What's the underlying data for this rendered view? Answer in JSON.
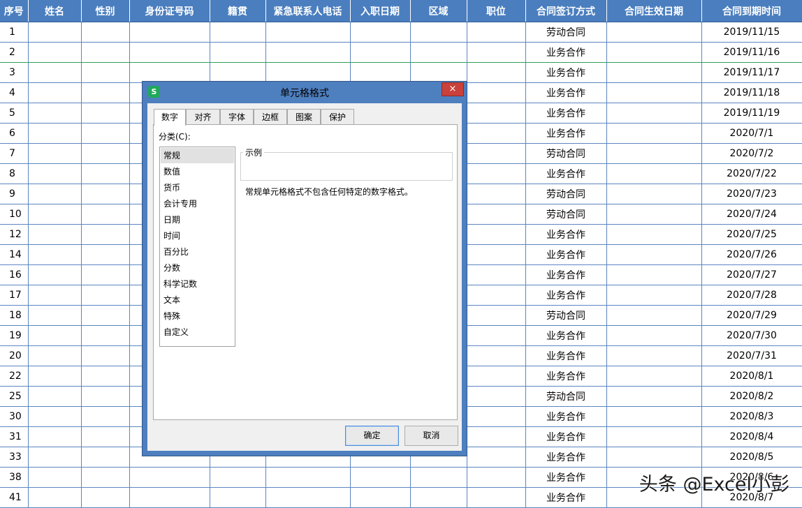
{
  "sheet": {
    "headers": [
      "序号",
      "姓名",
      "性别",
      "身份证号码",
      "籍贯",
      "紧急联系人电话",
      "入职日期",
      "区域",
      "职位",
      "合同签订方式",
      "合同生效日期",
      "合同到期时间"
    ],
    "rows": [
      {
        "seq": "1",
        "contract_type": "劳动合同",
        "expiry": "2019/11/15"
      },
      {
        "seq": "2",
        "contract_type": "业务合作",
        "expiry": "2019/11/16"
      },
      {
        "seq": "3",
        "contract_type": "业务合作",
        "expiry": "2019/11/17"
      },
      {
        "seq": "4",
        "contract_type": "业务合作",
        "expiry": "2019/11/18"
      },
      {
        "seq": "5",
        "contract_type": "业务合作",
        "expiry": "2019/11/19"
      },
      {
        "seq": "6",
        "contract_type": "业务合作",
        "expiry": "2020/7/1"
      },
      {
        "seq": "7",
        "contract_type": "劳动合同",
        "expiry": "2020/7/2"
      },
      {
        "seq": "8",
        "contract_type": "业务合作",
        "expiry": "2020/7/22"
      },
      {
        "seq": "9",
        "contract_type": "劳动合同",
        "expiry": "2020/7/23"
      },
      {
        "seq": "10",
        "contract_type": "劳动合同",
        "expiry": "2020/7/24"
      },
      {
        "seq": "12",
        "contract_type": "业务合作",
        "expiry": "2020/7/25"
      },
      {
        "seq": "14",
        "contract_type": "业务合作",
        "expiry": "2020/7/26"
      },
      {
        "seq": "16",
        "contract_type": "业务合作",
        "expiry": "2020/7/27"
      },
      {
        "seq": "17",
        "contract_type": "业务合作",
        "expiry": "2020/7/28"
      },
      {
        "seq": "18",
        "contract_type": "劳动合同",
        "expiry": "2020/7/29"
      },
      {
        "seq": "19",
        "contract_type": "业务合作",
        "expiry": "2020/7/30"
      },
      {
        "seq": "20",
        "contract_type": "业务合作",
        "expiry": "2020/7/31"
      },
      {
        "seq": "22",
        "contract_type": "业务合作",
        "expiry": "2020/8/1"
      },
      {
        "seq": "25",
        "contract_type": "劳动合同",
        "expiry": "2020/8/2"
      },
      {
        "seq": "30",
        "contract_type": "业务合作",
        "expiry": "2020/8/3"
      },
      {
        "seq": "31",
        "contract_type": "业务合作",
        "expiry": "2020/8/4"
      },
      {
        "seq": "33",
        "contract_type": "业务合作",
        "expiry": "2020/8/5"
      },
      {
        "seq": "38",
        "contract_type": "业务合作",
        "expiry": "2020/8/6"
      },
      {
        "seq": "41",
        "contract_type": "业务合作",
        "expiry": "2020/8/7"
      }
    ]
  },
  "dialog": {
    "app_icon": "S",
    "title": "单元格格式",
    "close": "×",
    "tabs": [
      "数字",
      "对齐",
      "字体",
      "边框",
      "图案",
      "保护"
    ],
    "active_tab": "数字",
    "category_label": "分类(C):",
    "categories": [
      "常规",
      "数值",
      "货币",
      "会计专用",
      "日期",
      "时间",
      "百分比",
      "分数",
      "科学记数",
      "文本",
      "特殊",
      "自定义"
    ],
    "selected_category": "常规",
    "sample_label": "示例",
    "description": "常规单元格格式不包含任何特定的数字格式。",
    "ok": "确定",
    "cancel": "取消"
  },
  "watermark": "头条 @Excel小彭",
  "colors": {
    "header_bg": "#4a7ebe",
    "grid_line": "#5b85c0",
    "dialog_frame": "#4e7fbf",
    "close_button": "#c9413a"
  }
}
